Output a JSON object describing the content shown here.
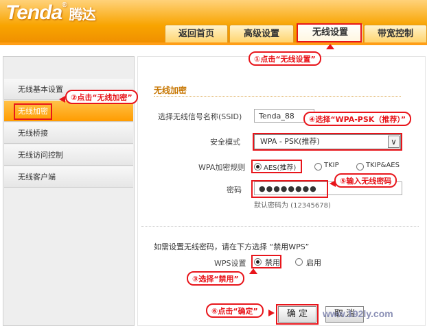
{
  "brand": {
    "logo": "Tenda",
    "logo_reg": "®",
    "logo_cn": "腾达"
  },
  "tabs": [
    {
      "label": "返回首页"
    },
    {
      "label": "高级设置"
    },
    {
      "label": "无线设置"
    },
    {
      "label": "带宽控制"
    }
  ],
  "sidebar": {
    "items": [
      {
        "label": "无线基本设置"
      },
      {
        "label": "无线加密"
      },
      {
        "label": "无线桥接"
      },
      {
        "label": "无线访问控制"
      },
      {
        "label": "无线客户端"
      }
    ]
  },
  "form": {
    "section_title": "无线加密",
    "ssid_label": "选择无线信号名称(SSID)",
    "ssid_value": "Tenda_88",
    "security_label": "安全模式",
    "security_value": "WPA - PSK(推荐)",
    "cipher_label": "WPA加密规则",
    "cipher_options": [
      {
        "label": "AES(推荐)",
        "checked": true
      },
      {
        "label": "TKIP",
        "checked": false
      },
      {
        "label": "TKIP&AES",
        "checked": false
      }
    ],
    "password_label": "密码",
    "password_value": "●●●●●●●●",
    "password_hint": "默认密码为 (12345678)",
    "wps_note": "如需设置无线密码，请在下方选择 “禁用WPS”",
    "wps_label": "WPS设置",
    "wps_options": [
      {
        "label": "禁用",
        "checked": true
      },
      {
        "label": "启用",
        "checked": false
      }
    ],
    "ok_label": "确 定",
    "cancel_label": "取 消"
  },
  "annotations": {
    "step1": "①点击“无线设置”",
    "step2": "②点击“无线加密”",
    "step3": "③选择“禁用”",
    "step4": "④选择“WPA-PSK（推荐）”",
    "step5": "⑤输入无线密码",
    "step6": "⑥点击“确定”",
    "annotation_color": "#e8151b"
  },
  "watermark": "www.192ly.com"
}
